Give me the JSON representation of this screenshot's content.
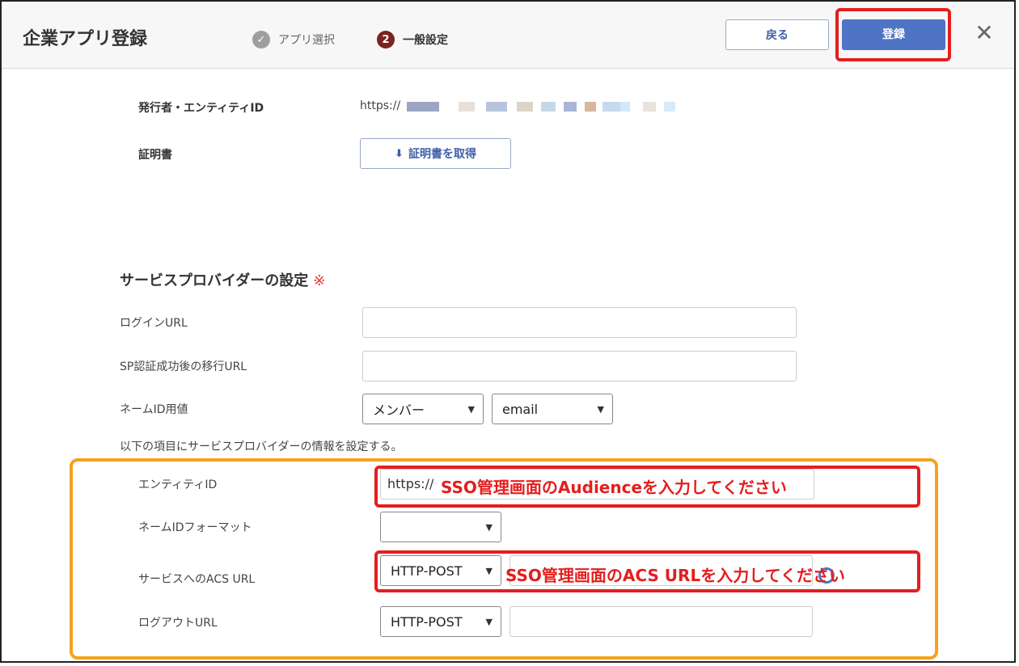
{
  "header": {
    "title": "企業アプリ登録",
    "steps": [
      {
        "label": "アプリ選択",
        "marker": "✓",
        "state": "done"
      },
      {
        "label": "一般設定",
        "marker": "2",
        "state": "current"
      }
    ],
    "back_label": "戻る",
    "register_label": "登録",
    "close_glyph": "✕"
  },
  "issuer": {
    "label": "発行者・エンティティID",
    "value": "https://"
  },
  "certificate": {
    "label": "証明書",
    "button_label": "証明書を取得",
    "icon_glyph": "⬇"
  },
  "sp_settings": {
    "title": "サービスプロバイダーの設定",
    "required_mark": "※",
    "login_url_label": "ログインURL",
    "sp_redirect_label": "SP認証成功後の移行URL",
    "nameid_value_label": "ネームID用値",
    "nameid_source_select": "メンバー",
    "nameid_attr_select": "email",
    "note": "以下の項目にサービスプロバイダーの情報を設定する。",
    "entity_id_label": "エンティティID",
    "entity_id_value": "https://",
    "nameid_format_label": "ネームIDフォーマット",
    "nameid_format_select": "",
    "acs_label": "サービスへのACS URL",
    "acs_binding_select": "HTTP-POST",
    "logout_label": "ログアウトURL",
    "logout_binding_select": "HTTP-POST"
  },
  "annotations": {
    "entity_id_hint": "SSO管理画面のAudienceを入力してください",
    "acs_hint": "SSO管理画面のACS URLを入力してください"
  },
  "colors": {
    "primary": "#4f73c5",
    "highlight_red": "#e41e1e",
    "highlight_orange": "#f4a21f",
    "step_current": "#7a2320"
  }
}
